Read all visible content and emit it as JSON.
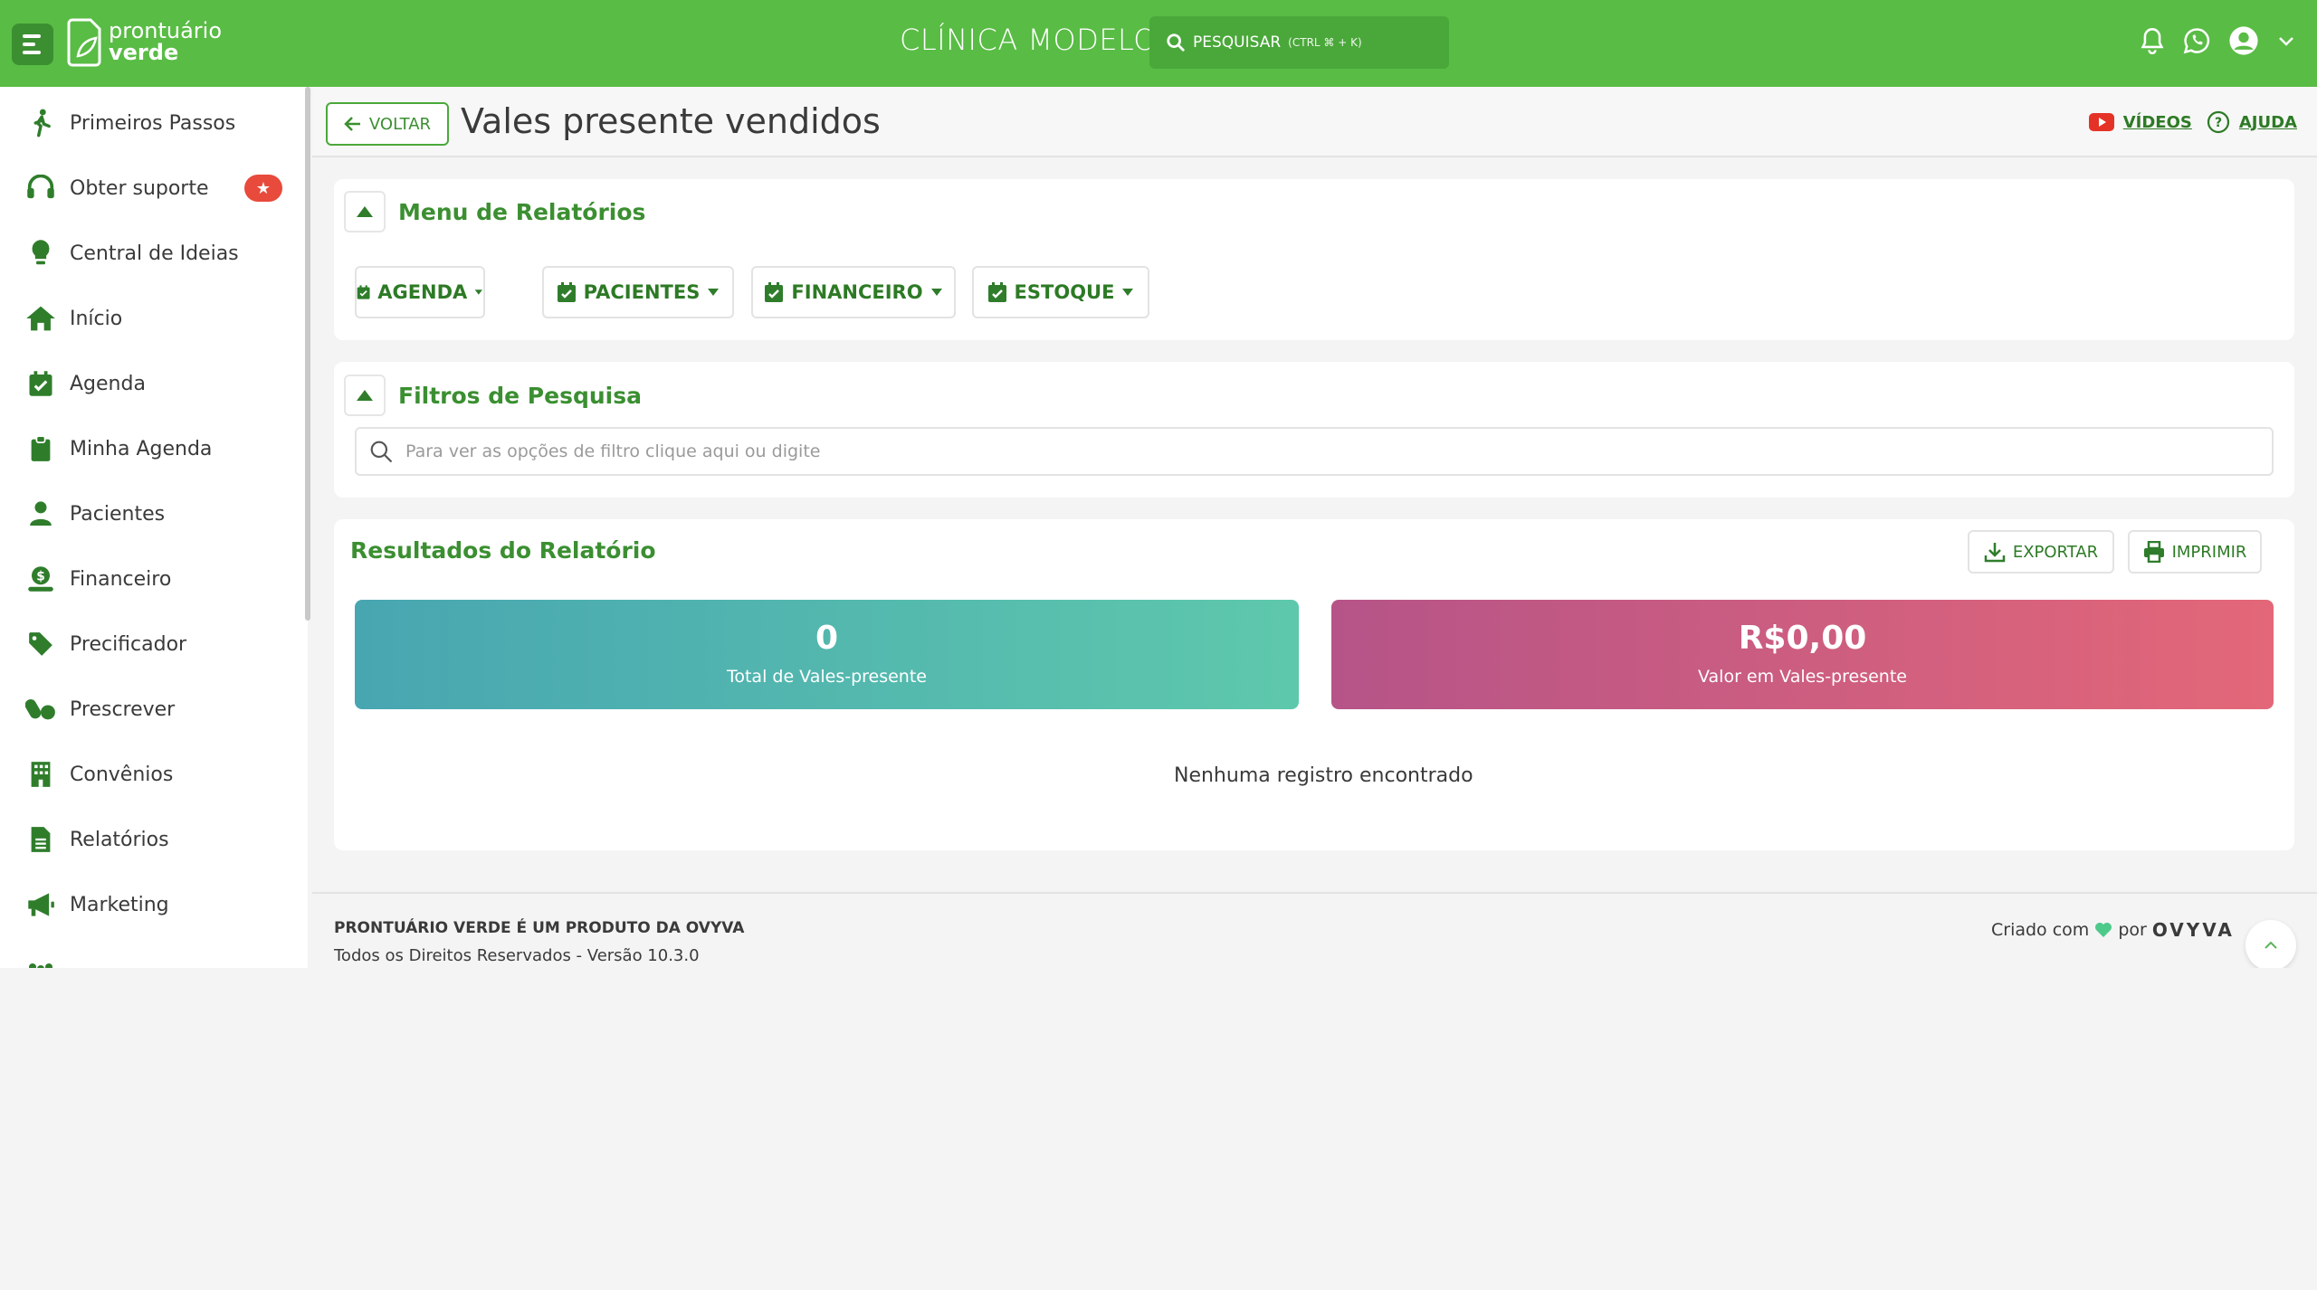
{
  "brand": {
    "logo_line1": "prontuário",
    "logo_line2": "verde",
    "green": "#59bc45"
  },
  "header": {
    "clinic_name": "CLÍNICA MODELO",
    "search_label": "PESQUISAR",
    "search_shortcut": "(CTRL ⌘ + K)"
  },
  "sidebar": {
    "items": [
      {
        "label": "Primeiros Passos",
        "icon": "walking-person-icon"
      },
      {
        "label": "Obter suporte",
        "icon": "headset-icon",
        "badge": "★"
      },
      {
        "label": "Central de Ideias",
        "icon": "lightbulb-icon"
      },
      {
        "label": "Início",
        "icon": "home-icon"
      },
      {
        "label": "Agenda",
        "icon": "calendar-check-icon"
      },
      {
        "label": "Minha Agenda",
        "icon": "clipboard-icon"
      },
      {
        "label": "Pacientes",
        "icon": "user-icon"
      },
      {
        "label": "Financeiro",
        "icon": "money-hand-icon"
      },
      {
        "label": "Precificador",
        "icon": "tag-icon"
      },
      {
        "label": "Prescrever",
        "icon": "pills-icon"
      },
      {
        "label": "Convênios",
        "icon": "building-icon"
      },
      {
        "label": "Relatórios",
        "icon": "document-icon"
      },
      {
        "label": "Marketing",
        "icon": "megaphone-icon"
      }
    ]
  },
  "page": {
    "back_label": "VOLTAR",
    "title": "Vales presente vendidos",
    "videos_label": "VÍDEOS",
    "help_label": "AJUDA"
  },
  "reports_menu": {
    "title": "Menu de Relatórios",
    "buttons": [
      "AGENDA",
      "PACIENTES",
      "FINANCEIRO",
      "ESTOQUE"
    ]
  },
  "filters": {
    "title": "Filtros de Pesquisa",
    "placeholder": "Para ver as opções de filtro clique aqui ou digite"
  },
  "results": {
    "title": "Resultados do Relatório",
    "export_label": "EXPORTAR",
    "print_label": "IMPRIMIR",
    "total_value": "0",
    "total_caption": "Total de Vales-presente",
    "amount_value": "R$0,00",
    "amount_caption": "Valor em Vales-presente",
    "empty_message": "Nenhuma registro encontrado"
  },
  "footer": {
    "product": "PRONTUÁRIO VERDE É UM PRODUTO DA OVYVA",
    "rights": "Todos os Direitos Reservados - Versão 10.3.0",
    "made_with": "Criado com",
    "by": "por",
    "company": "OVYVA"
  }
}
